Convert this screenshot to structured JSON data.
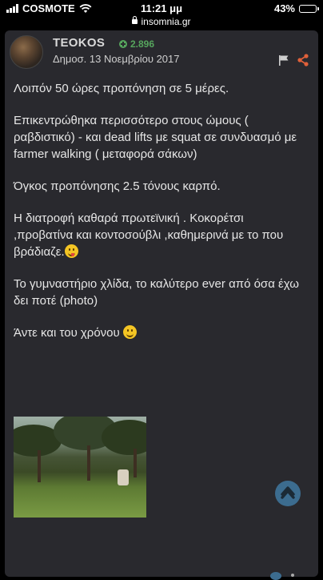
{
  "status": {
    "carrier": "COSMOTE",
    "time": "11:21 μμ",
    "battery": "43%",
    "battery_level": 0.43
  },
  "browser": {
    "domain": "insomnia.gr"
  },
  "post": {
    "author": "TEOKOS",
    "reputation": "2.896",
    "date": "Δημοσ. 13 Νοεμβρίου 2017",
    "paragraphs": [
      "Λοιπόν 50 ώρες προπόνηση σε 5 μέρες.",
      "Επικεντρώθηκα περισσότερο στους ώμους ( ραβδιστικό) - και dead lifts με squat σε συνδυασμό με farmer walking ( μεταφορά σάκων)",
      "Όγκος προπόνησης 2.5 τόνους καρπό.",
      "Η διατροφή καθαρά πρωτεϊνική . Κοκορέτσι ,προβατίνα και κοντοσούβλι ,καθημερινά με το που βράδιαζε.",
      "Το γυμναστήριο χλίδα, το καλύτερο ever από όσα έχω δει ποτέ (photo)",
      "Άντε και του χρόνου"
    ],
    "icons": {
      "flag": "flag-icon",
      "share": "share-icon",
      "reputation": "plus-circle-icon",
      "scroll": "chevron-up-icon"
    },
    "colors": {
      "background": "#29292e",
      "reputation": "#56a55d",
      "share": "#e0603a",
      "scroll_button": "#3c6c8f"
    }
  }
}
